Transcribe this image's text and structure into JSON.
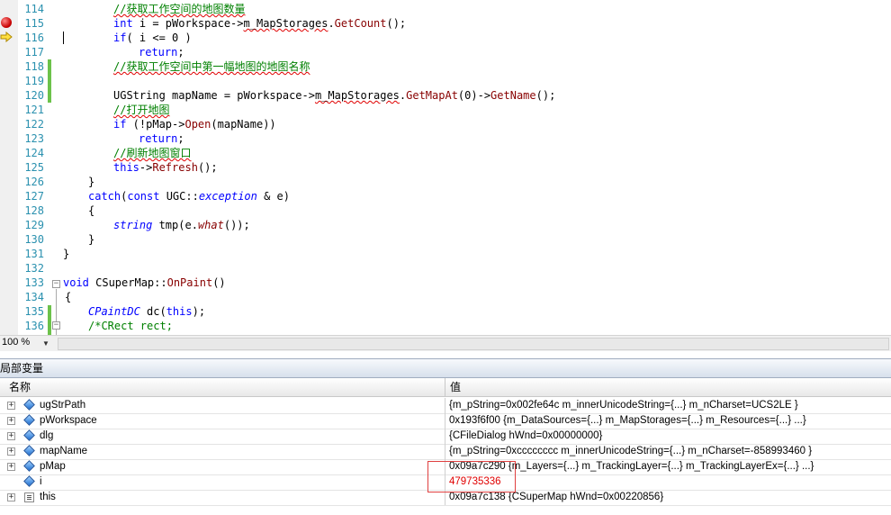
{
  "editor": {
    "zoom": "100 %",
    "lines": [
      {
        "num": "114"
      },
      {
        "num": "115"
      },
      {
        "num": "116"
      },
      {
        "num": "117"
      },
      {
        "num": "118"
      },
      {
        "num": "119"
      },
      {
        "num": "120"
      },
      {
        "num": "121"
      },
      {
        "num": "122"
      },
      {
        "num": "123"
      },
      {
        "num": "124"
      },
      {
        "num": "125"
      },
      {
        "num": "126"
      },
      {
        "num": "127"
      },
      {
        "num": "128"
      },
      {
        "num": "129"
      },
      {
        "num": "130"
      },
      {
        "num": "131"
      },
      {
        "num": "132"
      },
      {
        "num": "133"
      },
      {
        "num": "134"
      },
      {
        "num": "135"
      },
      {
        "num": "136"
      }
    ],
    "code": {
      "l114": "//获取工作空间的地图数量",
      "l115_kw": "int",
      "l115_a": " i = pWorkspace->",
      "l115_mb": "m_MapStorages",
      "l115_b": ".",
      "l115_fn": "GetCount",
      "l115_c": "();",
      "l116_kw": "if",
      "l116_a": "( i <= 0 )",
      "l117_kw": "return",
      "l117_a": ";",
      "l118": "//获取工作空间中第一幅地图的地图名称",
      "l120_a": "UGString mapName = pWorkspace->",
      "l120_mb": "m_MapStorages",
      "l120_b": ".",
      "l120_fn1": "GetMapAt",
      "l120_c": "(0)->",
      "l120_fn2": "GetName",
      "l120_d": "();",
      "l121": "//打开地图",
      "l122_kw": "if",
      "l122_a": " (!pMap->",
      "l122_fn": "Open",
      "l122_b": "(mapName))",
      "l123_kw": "return",
      "l123_a": ";",
      "l124": "//刷新地图窗口",
      "l125_kw": "this",
      "l125_a": "->",
      "l125_fn": "Refresh",
      "l125_b": "();",
      "l126": "}",
      "l127_kw1": "catch",
      "l127_a": "(",
      "l127_kw2": "const",
      "l127_b": " UGC::",
      "l127_ty": "exception",
      "l127_c": " & e)",
      "l128": "{",
      "l129_ty": "string",
      "l129_a": " tmp(e.",
      "l129_fn": "what",
      "l129_b": "());",
      "l130": "}",
      "l131": "}",
      "l133_kw": "void",
      "l133_a": " CSuperMap::",
      "l133_fn": "OnPaint",
      "l133_b": "()",
      "l134": "{",
      "l135_ty": "CPaintDC",
      "l135_a": " dc(",
      "l135_kw": "this",
      "l135_b": ");",
      "l136_a": "/*CRect rect;"
    }
  },
  "locals": {
    "title": "局部变量",
    "col_name": "名称",
    "col_value": "值",
    "rows": [
      {
        "expand": "+",
        "name": "ugStrPath",
        "value": "{m_pString=0x002fe64c m_innerUnicodeString={...} m_nCharset=UCS2LE }"
      },
      {
        "expand": "+",
        "name": "pWorkspace",
        "value": "0x193f6f00 {m_DataSources={...} m_MapStorages={...} m_Resources={...} ...}"
      },
      {
        "expand": "+",
        "name": "dlg",
        "value": "{CFileDialog hWnd=0x00000000}"
      },
      {
        "expand": "+",
        "name": "mapName",
        "value": "{m_pString=0xcccccccc m_innerUnicodeString={...} m_nCharset=-858993460 }"
      },
      {
        "expand": "+",
        "name": "pMap",
        "value": "0x09a7c290 {m_Layers={...} m_TrackingLayer={...} m_TrackingLayerEx={...} ...}"
      },
      {
        "expand": "",
        "name": "i",
        "value": "479735336"
      },
      {
        "expand": "+",
        "name": "this",
        "value": "0x09a7c138 {CSuperMap hWnd=0x00220856}"
      }
    ]
  },
  "colors": {
    "keyword": "#0000ff",
    "comment": "#008000",
    "line_number": "#2b91af",
    "changed_value": "#e00000"
  },
  "icons": [
    "breakpoint-icon",
    "current-statement-arrow-icon",
    "variable-icon",
    "object-icon",
    "expand-icon",
    "collapse-icon"
  ]
}
